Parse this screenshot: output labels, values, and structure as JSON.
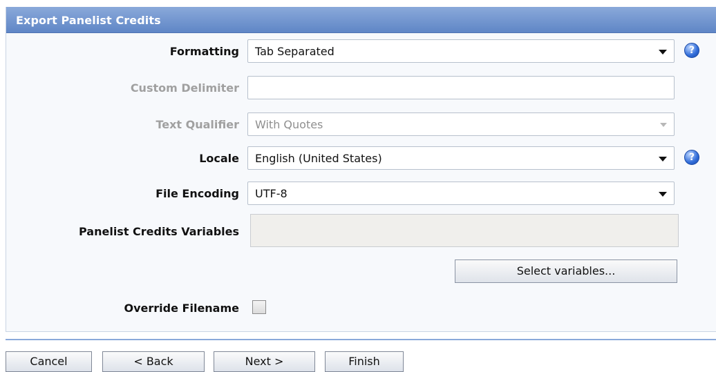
{
  "panel": {
    "title": "Export Panelist Credits"
  },
  "form": {
    "formatting": {
      "label": "Formatting",
      "value": "Tab Separated"
    },
    "custom_delimiter": {
      "label": "Custom Delimiter",
      "value": ""
    },
    "text_qualifier": {
      "label": "Text Qualifier",
      "value": "With Quotes"
    },
    "locale": {
      "label": "Locale",
      "value": "English (United States)"
    },
    "file_encoding": {
      "label": "File Encoding",
      "value": "UTF-8"
    },
    "panelist_credits_variables": {
      "label": "Panelist Credits Variables",
      "value": ""
    },
    "select_variables_button": "Select variables...",
    "override_filename": {
      "label": "Override Filename",
      "checked": false
    }
  },
  "help_icon_glyph": "?",
  "footer": {
    "cancel": "Cancel",
    "back": "< Back",
    "next": "Next >",
    "finish": "Finish"
  },
  "colors": {
    "header": "#5f86c6",
    "disabled_text": "#a0a0a0"
  }
}
